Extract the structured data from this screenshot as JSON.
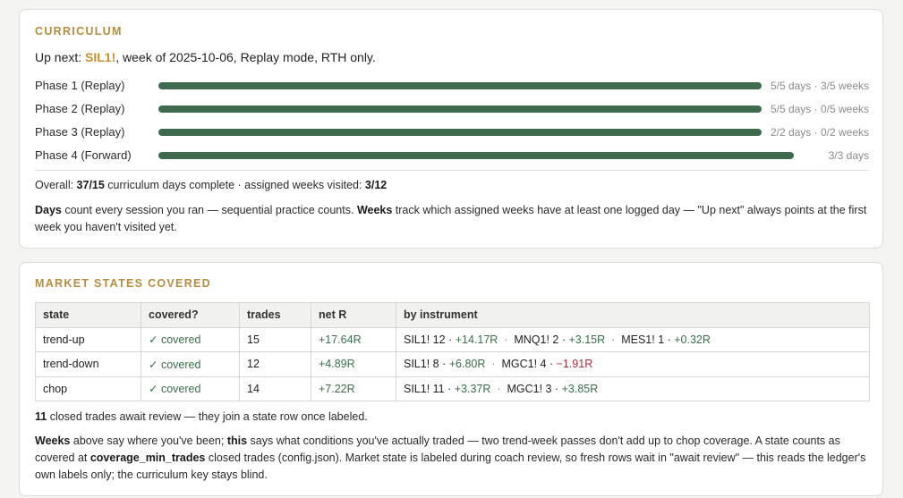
{
  "curriculum": {
    "title": "CURRICULUM",
    "upnext_prefix": "Up next: ",
    "upnext_symbol": "SIL1!",
    "upnext_suffix": ", week of 2025-10-06, Replay mode, RTH only.",
    "phases": [
      {
        "label": "Phase 1 (Replay)",
        "stat": "5/5 days · 3/5 weeks",
        "progress": 1.0
      },
      {
        "label": "Phase 2 (Replay)",
        "stat": "5/5 days · 0/5 weeks",
        "progress": 1.0
      },
      {
        "label": "Phase 3 (Replay)",
        "stat": "2/2 days · 0/2 weeks",
        "progress": 1.0
      },
      {
        "label": "Phase 4 (Forward)",
        "stat": "3/3 days",
        "progress": 1.0
      }
    ],
    "overall_prefix": "Overall: ",
    "overall_days": "37/15",
    "overall_mid": " curriculum days complete · assigned weeks visited: ",
    "overall_weeks": "3/12",
    "note_b1": "Days",
    "note_t1": " count every session you ran — sequential practice counts. ",
    "note_b2": "Weeks",
    "note_t2": " track which assigned weeks have at least one logged day — \"Up next\" always points at the first week you haven't visited yet."
  },
  "market_states": {
    "title": "MARKET STATES COVERED",
    "headers": [
      "state",
      "covered?",
      "trades",
      "net R",
      "by instrument"
    ],
    "rows": [
      {
        "state": "trend-up",
        "covered": "✓ covered",
        "trades": "15",
        "net_r": "+17.64R",
        "instruments": [
          {
            "text": "SIL1! 12 · ",
            "r": "+14.17R",
            "neg": false
          },
          {
            "text": "MNQ1! 2 · ",
            "r": "+3.15R",
            "neg": false
          },
          {
            "text": "MES1! 1 · ",
            "r": "+0.32R",
            "neg": false
          }
        ]
      },
      {
        "state": "trend-down",
        "covered": "✓ covered",
        "trades": "12",
        "net_r": "+4.89R",
        "instruments": [
          {
            "text": "SIL1! 8 · ",
            "r": "+6.80R",
            "neg": false
          },
          {
            "text": "MGC1! 4 · ",
            "r": "−1.91R",
            "neg": true
          }
        ]
      },
      {
        "state": "chop",
        "covered": "✓ covered",
        "trades": "14",
        "net_r": "+7.22R",
        "instruments": [
          {
            "text": "SIL1! 11 · ",
            "r": "+3.37R",
            "neg": false
          },
          {
            "text": "MGC1! 3 · ",
            "r": "+3.85R",
            "neg": false
          }
        ]
      }
    ],
    "await_count": "11",
    "await_text": " closed trades await review — they join a state row once labeled.",
    "note_b1": "Weeks",
    "note_t1": " above say where you've been; ",
    "note_b2": "this",
    "note_t2": " says what conditions you've actually traded — two trend-week passes don't add up to chop coverage. A state counts as covered at ",
    "note_b3": "coverage_min_trades",
    "note_t3": " closed trades (config.json). Market state is labeled during coach review, so fresh rows wait in \"await review\" — this reads the ledger's own labels only; the curriculum key stays blind."
  },
  "colors": {
    "accent_title": "#b68d3e",
    "symbol": "#c9912c",
    "bar": "#3e6b4e",
    "positive": "#3b6e4a",
    "negative": "#a5303c"
  }
}
